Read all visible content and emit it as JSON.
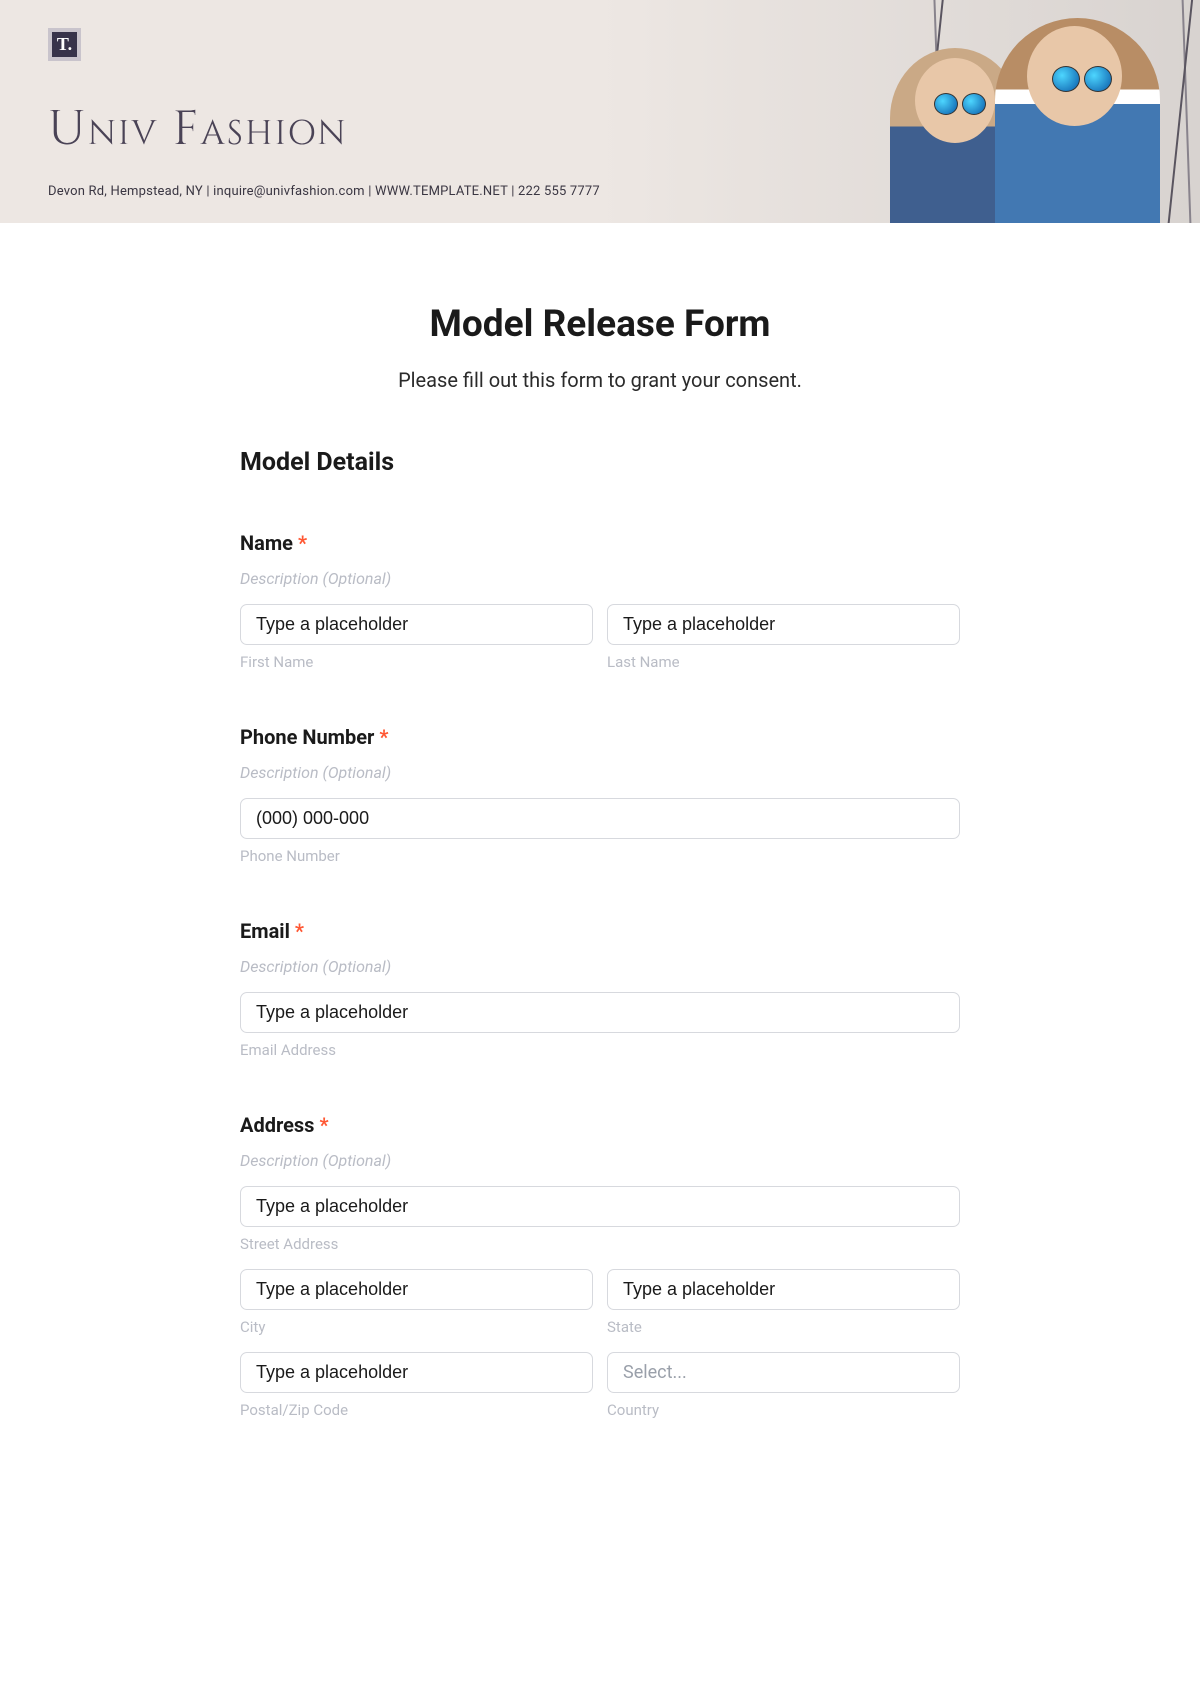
{
  "header": {
    "logo_text": "T.",
    "brand": "Univ Fashion",
    "contact": "Devon Rd, Hempstead, NY | inquire@univfashion.com | WWW.TEMPLATE.NET | 222 555 7777"
  },
  "form": {
    "title": "Model Release Form",
    "subtitle": "Please fill out this form to grant your consent.",
    "section_heading": "Model Details",
    "required_mark": "*",
    "desc_placeholder": "Description (Optional)",
    "generic_placeholder": "Type a placeholder",
    "fields": {
      "name": {
        "label": "Name",
        "first_sub": "First Name",
        "last_sub": "Last Name"
      },
      "phone": {
        "label": "Phone Number",
        "placeholder": "(000) 000-000",
        "sub": "Phone Number"
      },
      "email": {
        "label": "Email",
        "sub": "Email Address"
      },
      "address": {
        "label": "Address",
        "street_sub": "Street Address",
        "city_sub": "City",
        "state_sub": "State",
        "postal_sub": "Postal/Zip Code",
        "country_sub": "Country",
        "select_placeholder": "Select..."
      }
    }
  }
}
